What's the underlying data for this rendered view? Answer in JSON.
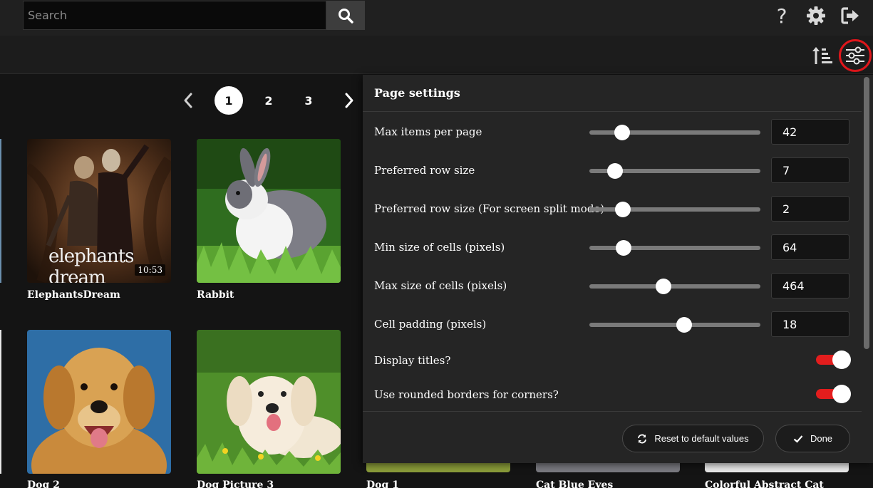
{
  "search": {
    "placeholder": "Search"
  },
  "topbar": {
    "help_glyph": "?",
    "icons": [
      "search-icon",
      "help-icon",
      "gear-icon",
      "logout-icon"
    ]
  },
  "subbar": {
    "icons": [
      "sort-ascending-icon",
      "sliders-icon"
    ],
    "highlight_color": "#e0161b"
  },
  "pagination": {
    "pages": [
      "1",
      "2",
      "3"
    ],
    "current": "1"
  },
  "gallery": {
    "items": [
      {
        "title": "ElephantsDream",
        "duration": "10:53"
      },
      {
        "title": "Rabbit"
      },
      {
        "title": "Dog 2"
      },
      {
        "title": "Dog Picture 3"
      },
      {
        "title": "Dog 1"
      },
      {
        "title": "Cat Blue Eyes"
      },
      {
        "title": "Colorful Abstract Cat"
      }
    ],
    "thumb_text": "elephants dream"
  },
  "settings": {
    "title": "Page settings",
    "sliders": [
      {
        "label": "Max items per page",
        "value": "42",
        "fraction": 0.19
      },
      {
        "label": "Preferred row size",
        "value": "7",
        "fraction": 0.15
      },
      {
        "label": "Preferred row size (For screen split mode)",
        "value": "2",
        "fraction": 0.195
      },
      {
        "label": "Min size of cells (pixels)",
        "value": "64",
        "fraction": 0.2
      },
      {
        "label": "Max size of cells (pixels)",
        "value": "464",
        "fraction": 0.435
      },
      {
        "label": "Cell padding (pixels)",
        "value": "18",
        "fraction": 0.555
      }
    ],
    "toggles": [
      {
        "label": "Display titles?",
        "on": true
      },
      {
        "label": "Use rounded borders for corners?",
        "on": true
      }
    ],
    "reset_label": "Reset to default values",
    "done_label": "Done",
    "accent_color": "#e31d1d"
  }
}
